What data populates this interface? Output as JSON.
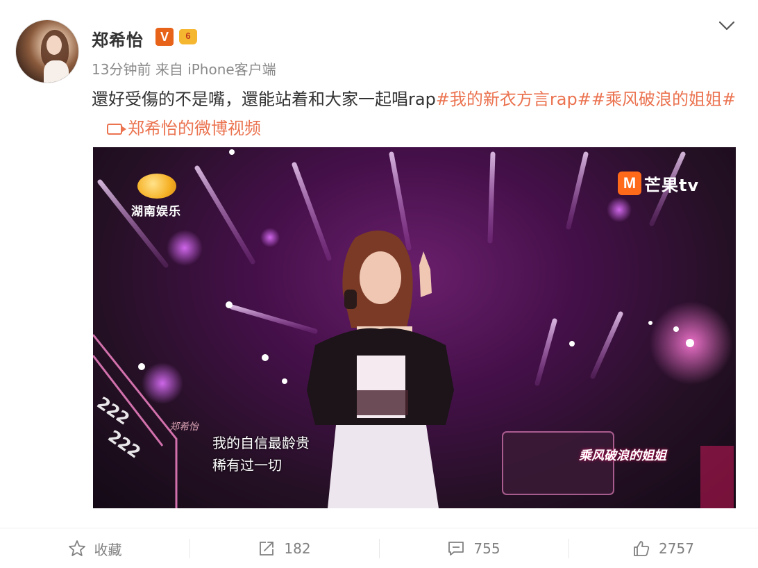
{
  "post": {
    "author": "郑希怡",
    "verified_badge": "V",
    "level_badge": "6",
    "time": "13分钟前",
    "source_prefix": "来自",
    "source": "iPhone客户端",
    "text_main": "還好受傷的不是嘴，還能站着和大家一起唱rap",
    "hashtag_1": "#我的新衣方言rap#",
    "hashtag_2": "#乘风破浪的姐姐#",
    "video_link": "郑希怡的微博视频"
  },
  "video": {
    "channel_logo": "湖南娱乐",
    "platform_logo_mark": "M",
    "platform_logo_text": "芒果tv",
    "subtitle_line1": "我的自信最龄贵",
    "subtitle_line2": "稀有过一切",
    "name_tag": "郑希怡",
    "show_logo": "乘风破浪的姐姐"
  },
  "actions": {
    "favorite_label": "收藏",
    "repost_count": "182",
    "comment_count": "755",
    "like_count": "2757"
  },
  "colors": {
    "link": "#eb7350",
    "verified": "#e8631a",
    "muted": "#808080"
  },
  "icons": [
    "chevron-down-icon",
    "video-icon",
    "star-icon",
    "repost-icon",
    "comment-icon",
    "thumbs-up-icon"
  ]
}
